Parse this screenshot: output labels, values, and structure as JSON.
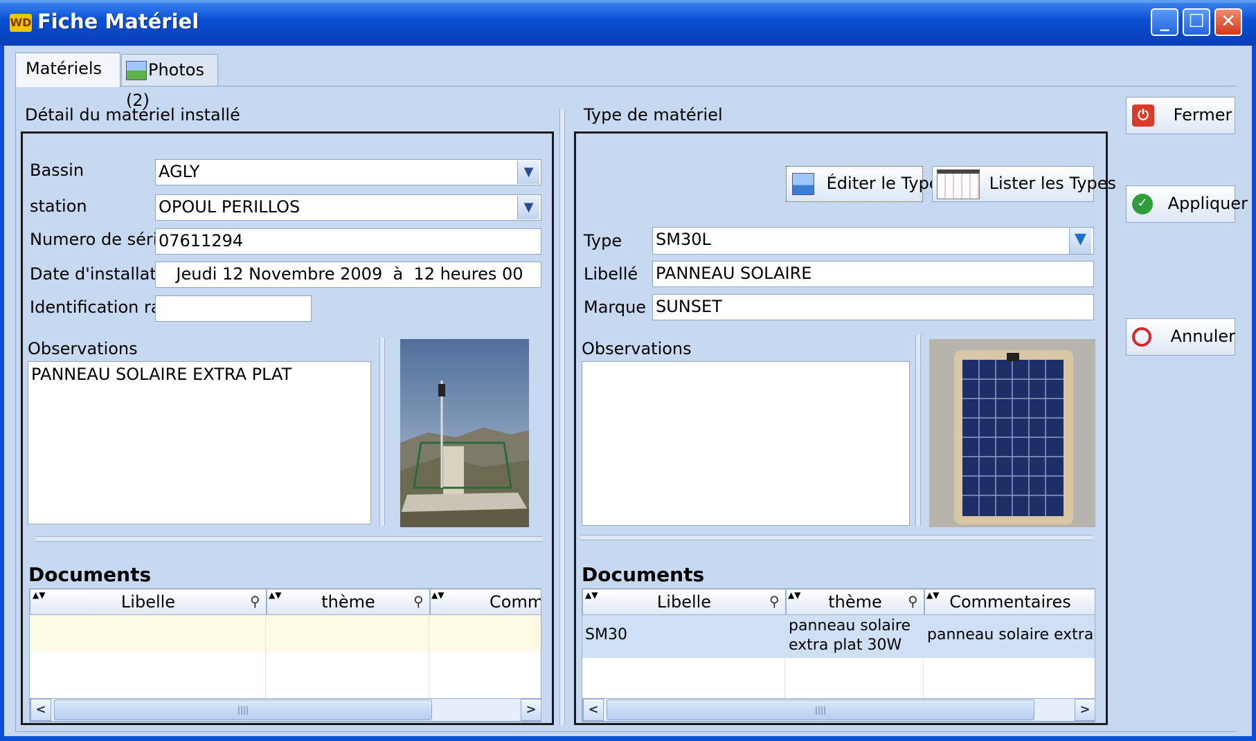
{
  "window": {
    "title": "Fiche Matériel",
    "logo": "WD"
  },
  "tabs": [
    {
      "label": "Matériels"
    },
    {
      "label": "Photos (2)"
    }
  ],
  "left": {
    "group_title": "Détail du matériel installé",
    "bassin": {
      "label": "Bassin",
      "value": "AGLY"
    },
    "station": {
      "label": "station",
      "value": "OPOUL PERILLOS"
    },
    "serial": {
      "label": "Numero de série",
      "value": "07611294"
    },
    "install_date": {
      "label": "Date d'installation",
      "value": "Jeudi 12 Novembre 2009  à  12 heures 00"
    },
    "radio_id": {
      "label": "Identification radio",
      "value": ""
    },
    "observations": {
      "label": "Observations",
      "value": "PANNEAU SOLAIRE EXTRA PLAT"
    },
    "documents": {
      "title": "Documents",
      "columns": [
        "Libelle",
        "thème",
        "Comme"
      ],
      "rows": []
    }
  },
  "right": {
    "group_title": "Type de matériel",
    "edit_type_label": "Éditer le Type",
    "list_types_label": "Lister les Types",
    "type": {
      "label": "Type",
      "value": "SM30L"
    },
    "libelle": {
      "label": "Libellé",
      "value": "PANNEAU SOLAIRE"
    },
    "marque": {
      "label": "Marque",
      "value": "SUNSET"
    },
    "observations": {
      "label": "Observations",
      "value": ""
    },
    "documents": {
      "title": "Documents",
      "columns": [
        "Libelle",
        "thème",
        "Commentaires"
      ],
      "rows": [
        {
          "libelle": "SM30",
          "theme_line1": "panneau solaire",
          "theme_line2": "extra plat 30W",
          "commentaires": "panneau solaire extra plat"
        }
      ]
    }
  },
  "actions": {
    "close": "Fermer",
    "apply": "Appliquer",
    "cancel": "Annuler"
  },
  "colors": {
    "titlebar": "#0a4fd4",
    "background": "#c6d9f1",
    "selected_row": "#cfe0f5",
    "empty_row": "#fdfbe6"
  }
}
